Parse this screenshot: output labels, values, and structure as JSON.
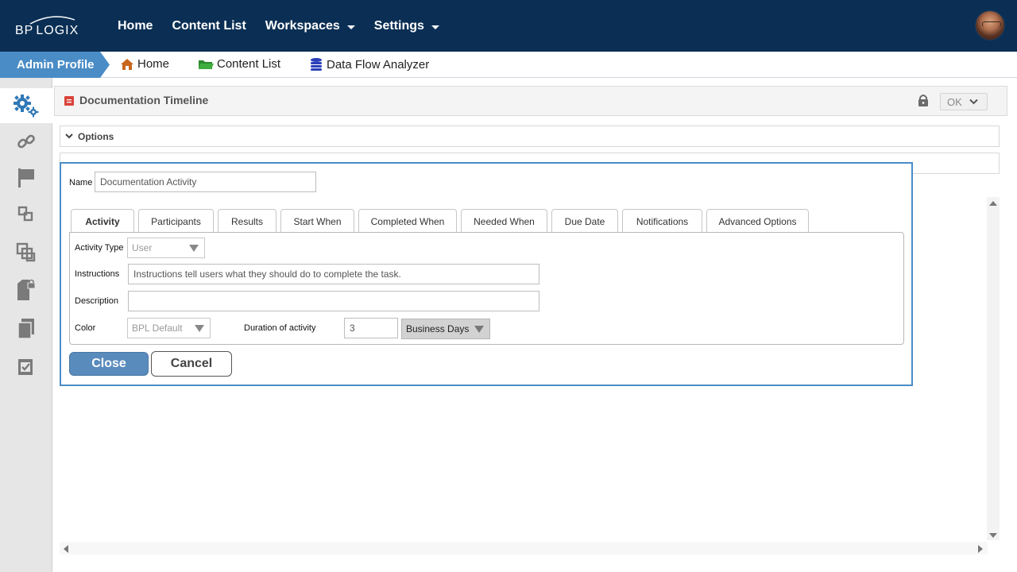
{
  "topbar": {
    "logo_bp": "BP",
    "logo_logix": "LOGIX",
    "nav": [
      {
        "label": "Home",
        "dropdown": false
      },
      {
        "label": "Content List",
        "dropdown": false
      },
      {
        "label": "Workspaces",
        "dropdown": true
      },
      {
        "label": "Settings",
        "dropdown": true
      }
    ]
  },
  "breadcrumb": {
    "admin_profile": "Admin Profile",
    "home": "Home",
    "content_list": "Content List",
    "data_flow": "Data Flow Analyzer"
  },
  "sidebar": {
    "icons": [
      "gears-icon",
      "link-icon",
      "flag-icon",
      "subprocess-icon",
      "copy-layers-icon",
      "locked-document-icon",
      "documents-icon",
      "checklist-icon"
    ]
  },
  "document": {
    "title": "Documentation Timeline",
    "ok_label": "OK",
    "options_label": "Options"
  },
  "dialog": {
    "name_label": "Name",
    "name_value": "Documentation Activity",
    "tabs": [
      "Activity",
      "Participants",
      "Results",
      "Start When",
      "Completed When",
      "Needed When",
      "Due Date",
      "Notifications",
      "Advanced Options"
    ],
    "activity_type_label": "Activity Type",
    "activity_type_value": "User",
    "instructions_label": "Instructions",
    "instructions_value": "Instructions tell users what they should do to complete the task.",
    "description_label": "Description",
    "description_value": "",
    "color_label": "Color",
    "color_value": "BPL Default",
    "duration_label": "Duration of activity",
    "duration_value": "3",
    "duration_unit": "Business Days",
    "close_label": "Close",
    "cancel_label": "Cancel"
  },
  "colors": {
    "topbar": "#0b2f54",
    "accent": "#4a8cc6",
    "close_button": "#5a8bbd"
  }
}
